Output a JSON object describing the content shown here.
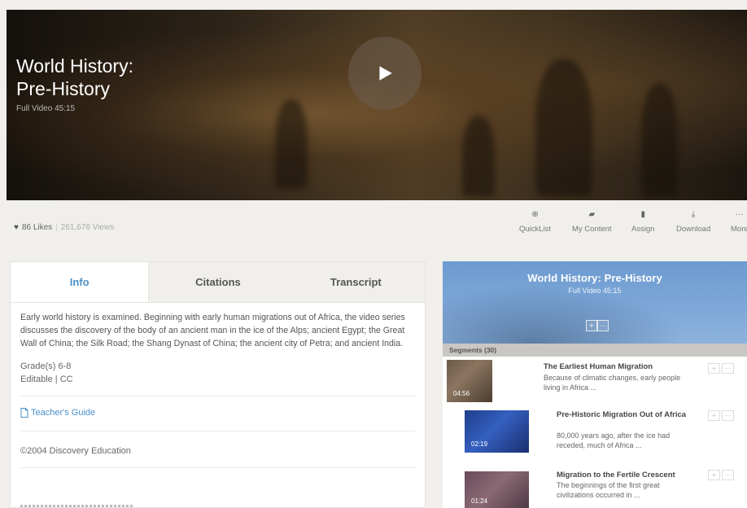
{
  "video": {
    "title_line1": "World History:",
    "title_line2": "Pre-History",
    "subtitle": "Full Video  45:15"
  },
  "stats": {
    "likes": "86 Likes",
    "separator": "|",
    "views": "261,676 Views"
  },
  "toolbar": {
    "quicklist": "QuickList",
    "my_content": "My Content",
    "assign": "Assign",
    "download": "Download",
    "more": "More"
  },
  "tabs": {
    "info": "Info",
    "citations": "Citations",
    "transcript": "Transcript"
  },
  "info": {
    "description": "Early world history is examined. Beginning with early human migrations out of Africa, the video series discusses the discovery of the body of an ancient man in the ice of the Alps; ancient Egypt; the Great Wall of China; the Silk Road; the Shang Dynast of China; the ancient city of Petra; and ancient India.",
    "grades": "Grade(s) 6-8",
    "editable": "Editable | CC",
    "teachers_guide": "Teacher's Guide",
    "copyright": "©2004 Discovery Education"
  },
  "panel": {
    "title": "World History: Pre-History",
    "subtitle": "Full Video  45:15",
    "segments_label": "Segments (30)",
    "segments": [
      {
        "title": "The Earliest Human Migration",
        "description": "Because of climatic changes, early people living in Africa ...",
        "duration": "04:56"
      },
      {
        "title": "Pre-Historic Migration Out of Africa",
        "description": "80,000 years ago, after the ice had receded, much of Africa ...",
        "duration": "02:19"
      },
      {
        "title": "Migration to the Fertile Crescent",
        "description": "The beginnings of the first great civilizations occurred in ...",
        "duration": "01:24"
      }
    ]
  },
  "colors": {
    "accent": "#4a8fc6",
    "panel_header": "#7ea8d8",
    "page_bg": "#f0efec"
  }
}
